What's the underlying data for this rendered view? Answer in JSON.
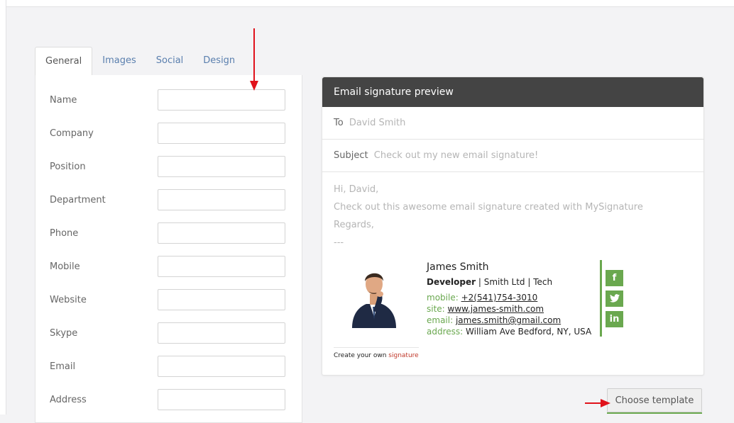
{
  "tabs": [
    {
      "label": "General",
      "active": true
    },
    {
      "label": "Images",
      "active": false
    },
    {
      "label": "Social",
      "active": false
    },
    {
      "label": "Design",
      "active": false
    }
  ],
  "form": {
    "fields": [
      {
        "label": "Name",
        "value": ""
      },
      {
        "label": "Company",
        "value": ""
      },
      {
        "label": "Position",
        "value": ""
      },
      {
        "label": "Department",
        "value": ""
      },
      {
        "label": "Phone",
        "value": ""
      },
      {
        "label": "Mobile",
        "value": ""
      },
      {
        "label": "Website",
        "value": ""
      },
      {
        "label": "Skype",
        "value": ""
      },
      {
        "label": "Email",
        "value": ""
      },
      {
        "label": "Address",
        "value": ""
      }
    ]
  },
  "preview": {
    "title": "Email signature preview",
    "to_label": "To",
    "to_value": "David Smith",
    "subject_label": "Subject",
    "subject_value": "Check out my new email signature!",
    "body_lines": [
      "Hi, David,",
      "Check out this awesome email signature created with MySignature",
      "Regards,",
      "---"
    ]
  },
  "signature": {
    "name": "James Smith",
    "position": "Developer",
    "company_line": " | Smith Ltd | Tech",
    "mobile_label": "mobile:",
    "mobile": "+2(541)754-3010",
    "site_label": "site:",
    "site": "www.james-smith.com",
    "email_label": "email:",
    "email": "james.smith@gmail.com",
    "address_label": "address:",
    "address": "William Ave Bedford, NY, USA",
    "social": [
      {
        "icon": "facebook-icon",
        "glyph": "f"
      },
      {
        "icon": "twitter-icon",
        "glyph": "t"
      },
      {
        "icon": "linkedin-icon",
        "glyph": "in"
      }
    ],
    "footer_text": "Create your own ",
    "footer_link": "signature",
    "accent_color": "#6aa84f"
  },
  "buttons": {
    "choose_template": "Choose template"
  },
  "colors": {
    "header_bg": "#444444",
    "arrow": "#e0121b",
    "link": "#c0392b"
  }
}
